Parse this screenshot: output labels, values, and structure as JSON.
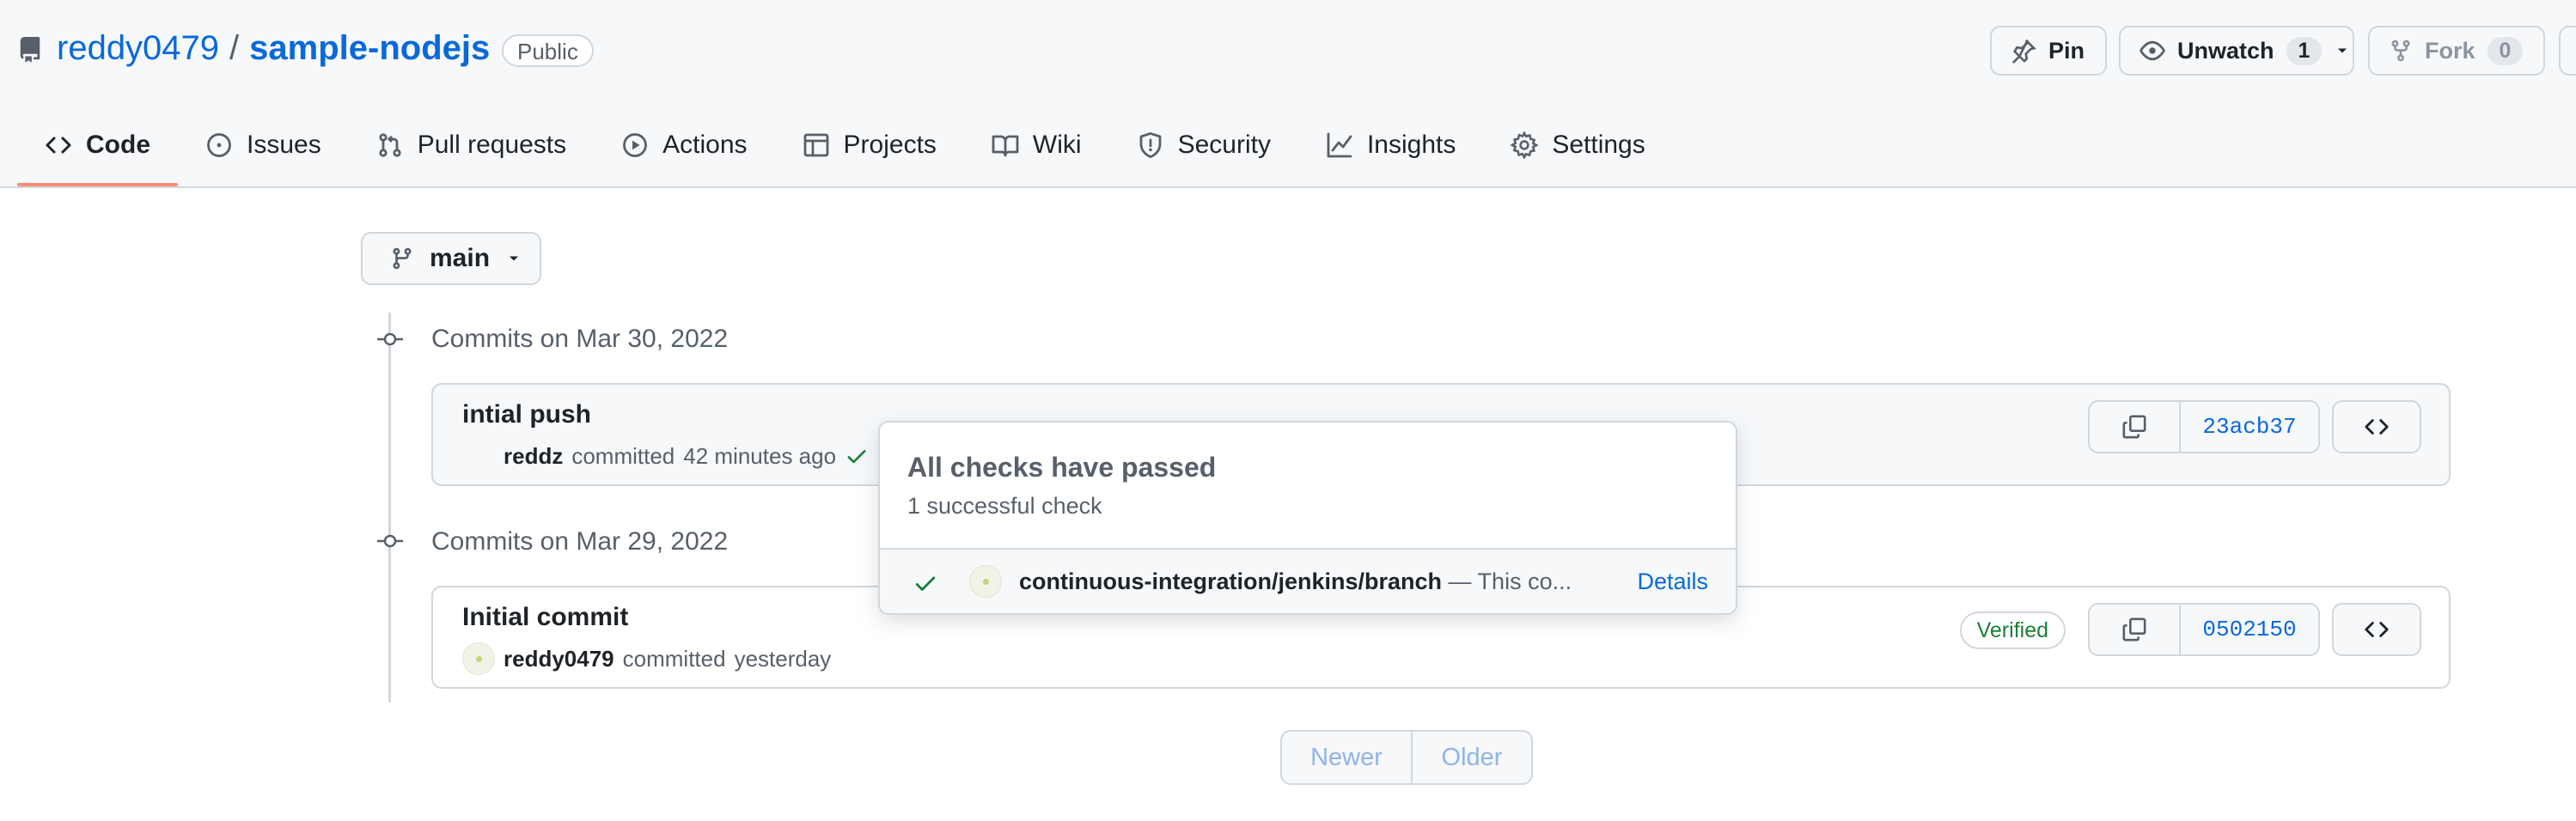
{
  "repo": {
    "owner": "reddy0479",
    "separator": "/",
    "name": "sample-nodejs",
    "visibility": "Public"
  },
  "actions": {
    "pin_label": "Pin",
    "unwatch_label": "Unwatch",
    "unwatch_count": "1",
    "fork_label": "Fork",
    "fork_count": "0"
  },
  "tabs": [
    {
      "label": "Code",
      "icon": "code-icon",
      "active": true
    },
    {
      "label": "Issues",
      "icon": "issue-icon"
    },
    {
      "label": "Pull requests",
      "icon": "pull-request-icon"
    },
    {
      "label": "Actions",
      "icon": "play-icon"
    },
    {
      "label": "Projects",
      "icon": "table-icon"
    },
    {
      "label": "Wiki",
      "icon": "book-icon"
    },
    {
      "label": "Security",
      "icon": "shield-icon"
    },
    {
      "label": "Insights",
      "icon": "graph-icon"
    },
    {
      "label": "Settings",
      "icon": "gear-icon"
    }
  ],
  "branch": {
    "name": "main"
  },
  "commit_groups": [
    {
      "title": "Commits on Mar 30, 2022",
      "commits": [
        {
          "message": "intial push",
          "author": "reddz",
          "action_text": "committed",
          "time": "42 minutes ago",
          "sha": "23acb37",
          "status": "success"
        }
      ]
    },
    {
      "title": "Commits on Mar 29, 2022",
      "commits": [
        {
          "message": "Initial commit",
          "author": "reddy0479",
          "action_text": "committed",
          "time": "yesterday",
          "sha": "0502150",
          "badge": "Verified"
        }
      ]
    }
  ],
  "checks_popover": {
    "title": "All checks have passed",
    "subtitle": "1 successful check",
    "check": {
      "context": "continuous-integration/jenkins/branch",
      "description": "— This co...",
      "details_label": "Details"
    }
  },
  "pagination": {
    "newer": "Newer",
    "older": "Older"
  },
  "colors": {
    "link": "#0969da",
    "success": "#1a7f37",
    "active_tab_underline": "#fd8c73",
    "border": "#d0d7de"
  }
}
